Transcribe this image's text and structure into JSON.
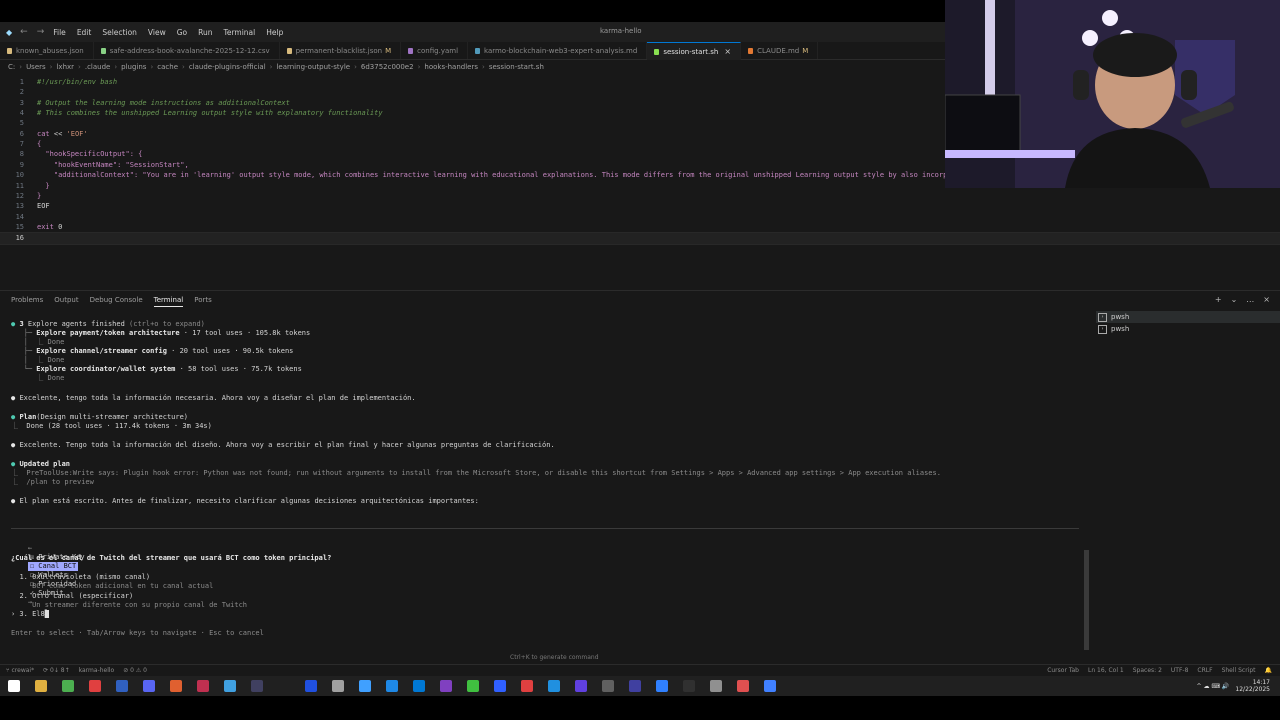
{
  "app": {
    "title": "karma-hello",
    "menu": [
      "File",
      "Edit",
      "Selection",
      "View",
      "Go",
      "Run",
      "Terminal",
      "Help"
    ]
  },
  "tabs": [
    {
      "label": "known_abuses.json",
      "color": "#d7ba7d",
      "modified": ""
    },
    {
      "label": "safe-address-book-avalanche-2025-12-12.csv",
      "color": "#89d185",
      "modified": ""
    },
    {
      "label": "permanent-blacklist.json",
      "color": "#d7ba7d",
      "modified": "M"
    },
    {
      "label": "config.yaml",
      "color": "#a074c4",
      "modified": ""
    },
    {
      "label": "karmo-blockchain-web3-expert-analysis.md",
      "color": "#519aba",
      "modified": ""
    },
    {
      "label": "session-start.sh",
      "color": "#89e051",
      "modified": "",
      "active": true,
      "close": "×"
    },
    {
      "label": "CLAUDE.md",
      "color": "#e37933",
      "modified": "M"
    }
  ],
  "breadcrumb": [
    "C:",
    "Users",
    "lxhxr",
    ".claude",
    "plugins",
    "cache",
    "claude-plugins-official",
    "learning-output-style",
    "6d3752c000e2",
    "hooks-handlers",
    "session-start.sh"
  ],
  "code_lines": [
    {
      "n": "1",
      "parts": [
        {
          "t": "#!/usr/bin/env bash",
          "c": "c-comment"
        }
      ]
    },
    {
      "n": "2",
      "parts": []
    },
    {
      "n": "3",
      "parts": [
        {
          "t": "# Output the learning mode instructions as additionalContext",
          "c": "c-comment"
        }
      ]
    },
    {
      "n": "4",
      "parts": [
        {
          "t": "# This combines the unshipped Learning output style with explanatory functionality",
          "c": "c-comment"
        }
      ]
    },
    {
      "n": "5",
      "parts": []
    },
    {
      "n": "6",
      "parts": [
        {
          "t": "cat ",
          "c": "c-kw"
        },
        {
          "t": "<< ",
          "c": "c-plain"
        },
        {
          "t": "'EOF'",
          "c": "c-str"
        }
      ]
    },
    {
      "n": "7",
      "parts": [
        {
          "t": "{",
          "c": "c-kw"
        }
      ]
    },
    {
      "n": "8",
      "parts": [
        {
          "t": "  \"hookSpecificOutput\"",
          "c": "c-kw"
        },
        {
          "t": ": {",
          "c": "c-kw"
        }
      ]
    },
    {
      "n": "9",
      "parts": [
        {
          "t": "    \"hookEventName\"",
          "c": "c-kw"
        },
        {
          "t": ": ",
          "c": "c-kw"
        },
        {
          "t": "\"SessionStart\"",
          "c": "c-kw"
        },
        {
          "t": ",",
          "c": "c-kw"
        }
      ]
    },
    {
      "n": "10",
      "parts": [
        {
          "t": "    \"additionalContext\"",
          "c": "c-kw"
        },
        {
          "t": ": ",
          "c": "c-kw"
        },
        {
          "t": "\"You are in 'learning' output style mode, which combines interactive learning with educational explanations. This mode differs from the original unshipped Learning output style by also incorp",
          "c": "c-kw"
        }
      ]
    },
    {
      "n": "11",
      "parts": [
        {
          "t": "  }",
          "c": "c-kw"
        }
      ]
    },
    {
      "n": "12",
      "parts": [
        {
          "t": "}",
          "c": "c-kw"
        }
      ]
    },
    {
      "n": "13",
      "parts": [
        {
          "t": "EOF",
          "c": "c-plain"
        }
      ]
    },
    {
      "n": "14",
      "parts": []
    },
    {
      "n": "15",
      "parts": [
        {
          "t": "exit ",
          "c": "c-kw"
        },
        {
          "t": "0",
          "c": "c-plain"
        }
      ]
    },
    {
      "n": "16",
      "parts": [],
      "current": true
    }
  ],
  "panel": {
    "tabs": [
      "Problems",
      "Output",
      "Debug Console",
      "Terminal",
      "Ports"
    ],
    "active_tab": "Terminal",
    "actions": [
      "+",
      "⌄",
      "…",
      "×"
    ],
    "terminals": [
      "pwsh",
      "pwsh"
    ]
  },
  "terminal": {
    "explore_header": {
      "count": "3",
      "text": " Explore agents finished ",
      "hint": "(ctrl+o to expand)"
    },
    "agents": [
      {
        "name": "Explore payment/token architecture",
        "stats": " · 17 tool uses · 105.8k tokens",
        "status": "Done"
      },
      {
        "name": "Explore channel/streamer config",
        "stats": " · 20 tool uses · 90.5k tokens",
        "status": "Done"
      },
      {
        "name": "Explore coordinator/wallet system",
        "stats": " · 58 tool uses · 75.7k tokens",
        "status": "Done"
      }
    ],
    "msg1": "Excelente, tengo toda la información necesaria. Ahora voy a diseñar el plan de implementación.",
    "plan_label": "Plan",
    "plan_arg": "(Design multi-streamer architecture)",
    "plan_done": "  Done (28 tool uses · 117.4k tokens · 3m 34s)",
    "msg2": "Excelente. Tengo toda la información del diseño. Ahora voy a escribir el plan final y hacer algunas preguntas de clarificación.",
    "updated_plan": "Updated plan",
    "hook_error": "  PreToolUse:Write says: Plugin hook error: Python was not found; run without arguments to install from the Microsoft Store, or disable this shortcut from Settings > Apps > Advanced app settings > App execution aliases.",
    "plan_preview": "  /plan to preview",
    "msg3": "El plan está escrito. Antes de finalizar, necesito clarificar algunas decisiones arquitectónicas importantes:",
    "nav": {
      "left": "←",
      "private_key": "☒ Private Key",
      "canal_bct": "☐ Canal BCT",
      "wallets": "☐ Wallets",
      "prioridad": "☐ Prioridad",
      "submit": "✓ Submit",
      "right": "→"
    },
    "question": "¿Cuál es el canal de Twitch del streamer que usará BCT como token principal?",
    "options": [
      {
        "num": "1.",
        "label": "0xultravioleta (mismo canal)",
        "desc": "BCT como token adicional en tu canal actual"
      },
      {
        "num": "2.",
        "label": "Otro canal (especificar)",
        "desc": "Un streamer diferente con su propio canal de Twitch"
      }
    ],
    "option3_prefix": "› 3.",
    "option3_input": "El8",
    "help": "Enter to select · Tab/Arrow keys to navigate · Esc to cancel"
  },
  "ctrl_hint": "Ctrl+K to generate command",
  "status": {
    "left": [
      "⑂ crewai*",
      "⟳ 0↓ 8↑",
      "karma-hello",
      "⊘ 0 ⚠ 0"
    ],
    "right": [
      "Cursor Tab",
      "Ln 16, Col 1",
      "Spaces: 2",
      "UTF-8",
      "CRLF",
      "Shell Script",
      "🔔"
    ]
  },
  "taskbar": {
    "time": "14:17",
    "date": "12/22/2025",
    "tray": "^  ☁  ⌨  🔊"
  },
  "colors": {
    "accent": "#0078d4",
    "selected_chip": "#a0a8ff"
  }
}
